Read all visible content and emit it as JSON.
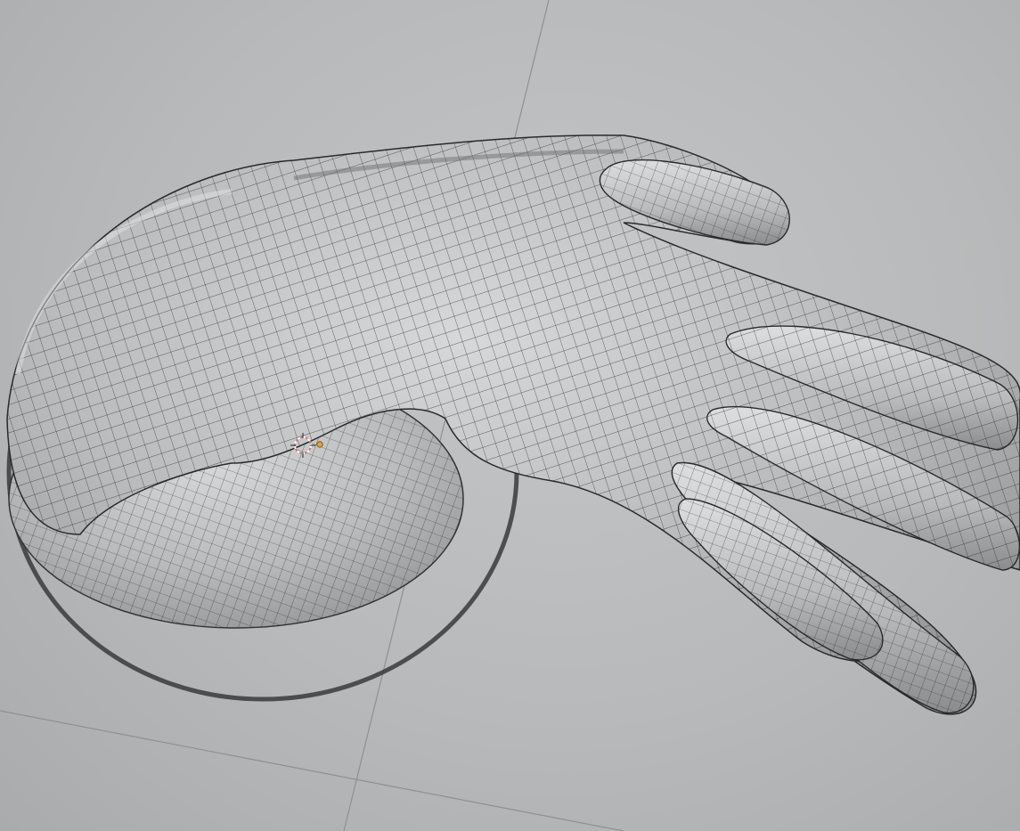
{
  "viewport": {
    "mode": "sculpt-wireframe-overlay",
    "background_color": "#b7b9ba",
    "mesh_color": "#c9cbcc",
    "wire_color": "#1d1d1d",
    "grid_line_color": "#8e9091",
    "ring_color": "#3a3a3a",
    "origin_marker_color": "#d07a7a",
    "pivot_dot_color": "#e4a23a"
  },
  "icons": {
    "object_origin": "3d-cursor-icon",
    "pivot": "pivot-dot-icon"
  }
}
